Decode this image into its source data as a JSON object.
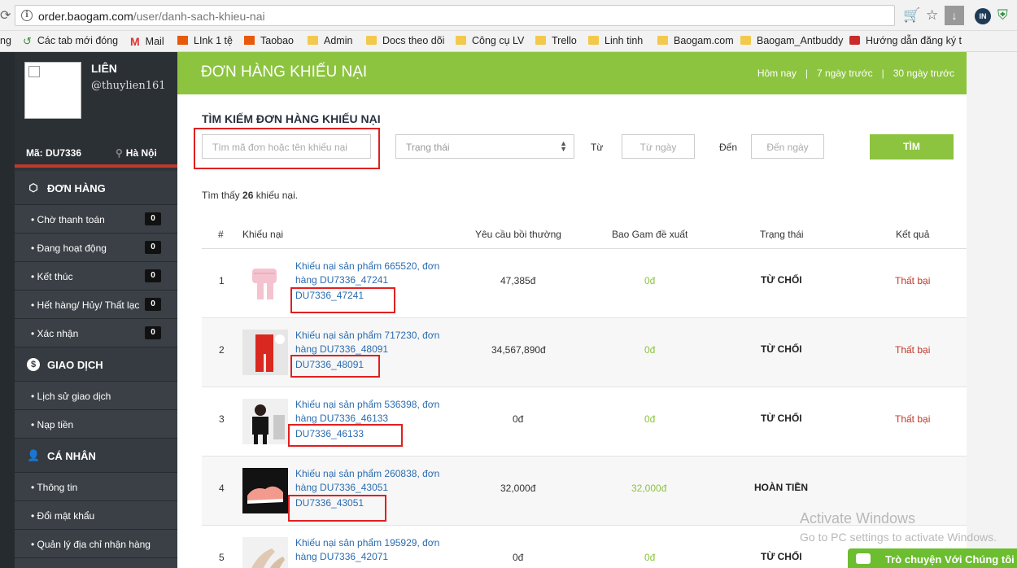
{
  "browser": {
    "url_host": "order.baogam.com",
    "url_path": "/user/danh-sach-khieu-nai",
    "bookmarks": [
      {
        "label": "ng",
        "icon": "partial-icon"
      },
      {
        "label": "Các tab mới đóng",
        "icon": "history-icon"
      },
      {
        "label": "Mail",
        "icon": "gmail-icon"
      },
      {
        "label": "LInk 1 tệ",
        "icon": "taobao-icon"
      },
      {
        "label": "Taobao",
        "icon": "taobao-icon"
      },
      {
        "label": "Admin",
        "icon": "folder-icon"
      },
      {
        "label": "Docs theo dõi",
        "icon": "folder-icon"
      },
      {
        "label": "Công cụ LV",
        "icon": "folder-icon"
      },
      {
        "label": "Trello",
        "icon": "folder-icon"
      },
      {
        "label": "Linh tinh",
        "icon": "folder-icon"
      },
      {
        "label": "Baogam.com",
        "icon": "folder-icon"
      },
      {
        "label": "Baogam_Antbuddy",
        "icon": "folder-icon"
      },
      {
        "label": "Hướng dẫn đăng ký t",
        "icon": "site-icon"
      }
    ]
  },
  "profile": {
    "name": "LIÊN",
    "username": "@thuylien161",
    "code": "Mã: DU7336",
    "city": "Hà Nội"
  },
  "sidebar": {
    "orders_title": "ĐƠN HÀNG",
    "orders": [
      {
        "label": "• Chờ thanh toán",
        "count": "0"
      },
      {
        "label": "• Đang hoạt động",
        "count": "0"
      },
      {
        "label": "• Kết thúc",
        "count": "0"
      },
      {
        "label": "• Hết hàng/ Hủy/ Thất lạc",
        "count": "0"
      },
      {
        "label": "• Xác nhận",
        "count": "0"
      }
    ],
    "transactions_title": "GIAO DỊCH",
    "transactions": [
      {
        "label": "• Lịch sử giao dịch"
      },
      {
        "label": "• Nạp tiền"
      }
    ],
    "personal_title": "CÁ NHÂN",
    "personal": [
      {
        "label": "• Thông tin"
      },
      {
        "label": "• Đổi mật khẩu"
      },
      {
        "label": "• Quản lý địa chỉ nhận hàng"
      }
    ]
  },
  "header": {
    "title": "ĐƠN HÀNG KHIẾU NẠI",
    "filters": [
      "Hôm nay",
      "7 ngày trước",
      "30 ngày trước"
    ]
  },
  "search": {
    "title": "TÌM KIẾM ĐƠN HÀNG KHIẾU NẠI",
    "keyword_placeholder": "Tìm mã đơn hoặc tên khiếu nại",
    "status_selected": "Trạng thái",
    "from_label": "Từ",
    "from_placeholder": "Từ ngày",
    "to_label": "Đến",
    "to_placeholder": "Đến ngày",
    "button": "TÌM"
  },
  "results": {
    "prefix": "Tìm thấy",
    "count": "26",
    "suffix": "khiếu nại."
  },
  "table": {
    "headers": [
      "#",
      "Khiếu nại",
      "Yêu cầu bồi thường",
      "Bao Gam đề xuất",
      "Trạng thái",
      "Kết quả"
    ],
    "rows": [
      {
        "num": "1",
        "title": "Khiếu nại sản phẩm 665520, đơn hàng DU7336_47241",
        "code": "DU7336_47241",
        "claim": "47,385đ",
        "proposal": "0đ",
        "status": "TỪ CHỐI",
        "result": "Thất bại"
      },
      {
        "num": "2",
        "title": "Khiếu nại sản phẩm 717230, đơn hàng DU7336_48091",
        "code": "DU7336_48091",
        "claim": "34,567,890đ",
        "proposal": "0đ",
        "status": "TỪ CHỐI",
        "result": "Thất bại"
      },
      {
        "num": "3",
        "title": "Khiếu nại sản phẩm 536398, đơn hàng DU7336_46133",
        "code": "DU7336_46133",
        "claim": "0đ",
        "proposal": "0đ",
        "status": "TỪ CHỐI",
        "result": "Thất bại"
      },
      {
        "num": "4",
        "title": "Khiếu nại sản phẩm 260838, đơn hàng DU7336_43051",
        "code": "DU7336_43051",
        "claim": "32,000đ",
        "proposal": "32,000đ",
        "status": "HOÀN TIỀN",
        "result": ""
      },
      {
        "num": "5",
        "title": "Khiếu nại sản phẩm 195929, đơn hàng DU7336_42071",
        "code": "",
        "claim": "0đ",
        "proposal": "0đ",
        "status": "TỪ CHỐI",
        "result": ""
      }
    ]
  },
  "overlay": {
    "activate_title": "Activate Windows",
    "activate_sub": "Go to PC settings to activate Windows.",
    "chat_label": "Trò chuyện Với Chúng tôi"
  },
  "colors": {
    "accent_green": "#8cc43f",
    "sidebar_dark": "#2f353a",
    "link_blue": "#2b6cb0",
    "fail_red": "#c0392b",
    "annotation_red": "#e02020"
  }
}
